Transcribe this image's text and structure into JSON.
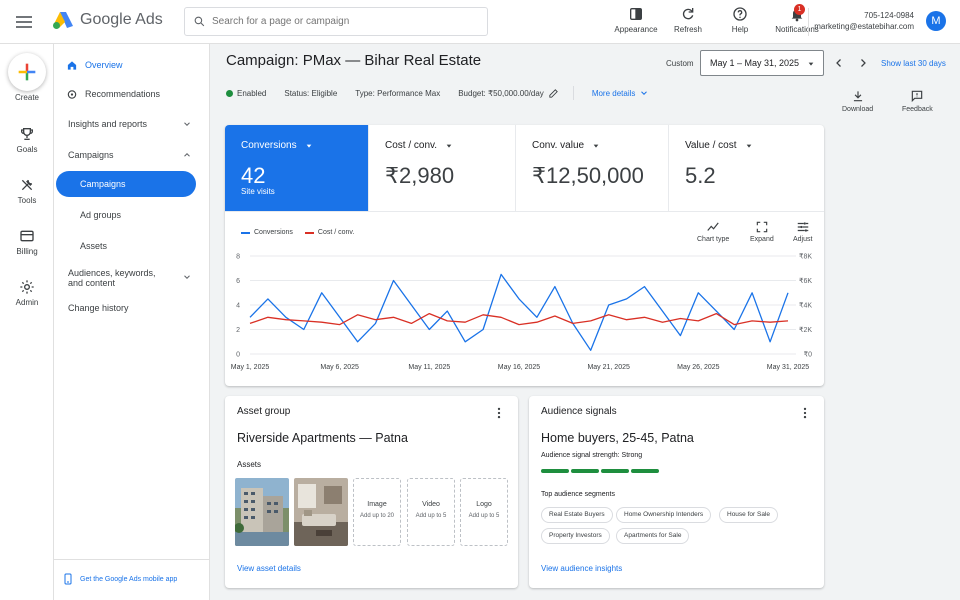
{
  "app": {
    "name": "Google Ads"
  },
  "search": {
    "placeholder": "Search for a page or campaign"
  },
  "top_actions": [
    {
      "label": "Appearance",
      "icon": "appearance-icon"
    },
    {
      "label": "Refresh",
      "icon": "refresh-icon"
    },
    {
      "label": "Help",
      "icon": "help-icon"
    },
    {
      "label": "Notifications",
      "icon": "bell-icon",
      "badge": "1"
    }
  ],
  "account": {
    "phone": "705-124-0984",
    "email": "marketing@estatebihar.com",
    "avatar": "M"
  },
  "rail": [
    {
      "label": "Create",
      "icon": "plus-icon"
    },
    {
      "label": "Goals",
      "icon": "trophy-icon"
    },
    {
      "label": "Tools",
      "icon": "tools-icon"
    },
    {
      "label": "Billing",
      "icon": "credit-card-icon"
    },
    {
      "label": "Admin",
      "icon": "gear-icon"
    }
  ],
  "nav": {
    "overview": "Overview",
    "recommendations": "Recommendations",
    "insights": "Insights and reports",
    "campaigns_section": "Campaigns",
    "campaigns": "Campaigns",
    "ad_groups": "Ad groups",
    "assets": "Assets",
    "audiences": "Audiences, keywords, and content",
    "change_history": "Change history",
    "mobile_app": "Get the Google Ads mobile app"
  },
  "campaign": {
    "title": "Campaign: PMax — Bihar Real Estate",
    "enabled": "Enabled",
    "status": "Status: Eligible",
    "type": "Type: Performance Max",
    "budget": "Budget: ₹50,000.00/day",
    "more_details": "More details"
  },
  "date": {
    "custom_label": "Custom",
    "range": "May 1 – May 31, 2025",
    "show_last": "Show last 30 days"
  },
  "tools": {
    "download": "Download",
    "feedback": "Feedback"
  },
  "metrics": [
    {
      "label": "Conversions",
      "value": "42",
      "sub": "Site visits"
    },
    {
      "label": "Cost / conv.",
      "value": "₹2,980",
      "sub": ""
    },
    {
      "label": "Conv. value",
      "value": "₹12,50,000",
      "sub": ""
    },
    {
      "label": "Value / cost",
      "value": "5.2",
      "sub": ""
    }
  ],
  "chart_tools": {
    "chart_type": "Chart type",
    "expand": "Expand",
    "adjust": "Adjust"
  },
  "colors": {
    "conversions": "#1a73e8",
    "cost": "#d93025",
    "accent": "#1a73e8",
    "enabled": "#1e8e3e"
  },
  "chart_data": {
    "type": "line",
    "x": [
      "May 1, 2025",
      "May 2, 2025",
      "May 3, 2025",
      "May 4, 2025",
      "May 5, 2025",
      "May 6, 2025",
      "May 7, 2025",
      "May 8, 2025",
      "May 9, 2025",
      "May 10, 2025",
      "May 11, 2025",
      "May 12, 2025",
      "May 13, 2025",
      "May 14, 2025",
      "May 15, 2025",
      "May 16, 2025",
      "May 17, 2025",
      "May 18, 2025",
      "May 19, 2025",
      "May 20, 2025",
      "May 21, 2025",
      "May 22, 2025",
      "May 23, 2025",
      "May 24, 2025",
      "May 25, 2025",
      "May 26, 2025",
      "May 27, 2025",
      "May 28, 2025",
      "May 29, 2025",
      "May 30, 2025",
      "May 31, 2025"
    ],
    "x_ticks": [
      "May 1, 2025",
      "May 6, 2025",
      "May 11, 2025",
      "May 16, 2025",
      "May 21, 2025",
      "May 26, 2025",
      "May 31, 2025"
    ],
    "y_left": {
      "ticks": [
        "0",
        "2",
        "4",
        "6",
        "8"
      ],
      "lim": [
        0,
        8
      ]
    },
    "y_right": {
      "ticks": [
        "₹0",
        "₹2K",
        "₹4K",
        "₹6K",
        "₹8K"
      ],
      "lim": [
        0,
        8000
      ]
    },
    "grid": true,
    "legend_position": "top-left",
    "series": [
      {
        "name": "Conversions",
        "axis": "left",
        "values": [
          3,
          4.5,
          3,
          2,
          5,
          3,
          1,
          2.5,
          6,
          4,
          2,
          3.5,
          1,
          2,
          6.5,
          4.5,
          3,
          5.5,
          2.5,
          0.3,
          4,
          4.5,
          5.5,
          3.5,
          1.5,
          5,
          3.5,
          2,
          5,
          1,
          5
        ]
      },
      {
        "name": "Cost / conv.",
        "axis": "right",
        "values": [
          2500,
          3000,
          2800,
          2700,
          2600,
          2400,
          3200,
          2800,
          3000,
          2500,
          3300,
          2700,
          2600,
          3200,
          3000,
          2400,
          2600,
          3100,
          2500,
          2700,
          3200,
          2800,
          3000,
          2600,
          2900,
          2700,
          3300,
          2400,
          2700,
          2600,
          2700
        ]
      }
    ]
  },
  "asset_group": {
    "header": "Asset group",
    "title": "Riverside Apartments — Patna",
    "assets_label": "Assets",
    "slots": [
      {
        "title": "Image",
        "sub": "Add up to 20"
      },
      {
        "title": "Video",
        "sub": "Add up to 5"
      },
      {
        "title": "Logo",
        "sub": "Add up to 5"
      }
    ],
    "link": "View asset details"
  },
  "audience": {
    "header": "Audience signals",
    "title": "Home buyers, 25-45, Patna",
    "strength": "Audience signal strength: Strong",
    "strength_level": "4 of 4",
    "segments_label": "Top audience segments",
    "segments": [
      "Real Estate Buyers",
      "Home Ownership Intenders",
      "House for Sale",
      "Property Investors",
      "Apartments for Sale"
    ],
    "link": "View audience insights"
  }
}
